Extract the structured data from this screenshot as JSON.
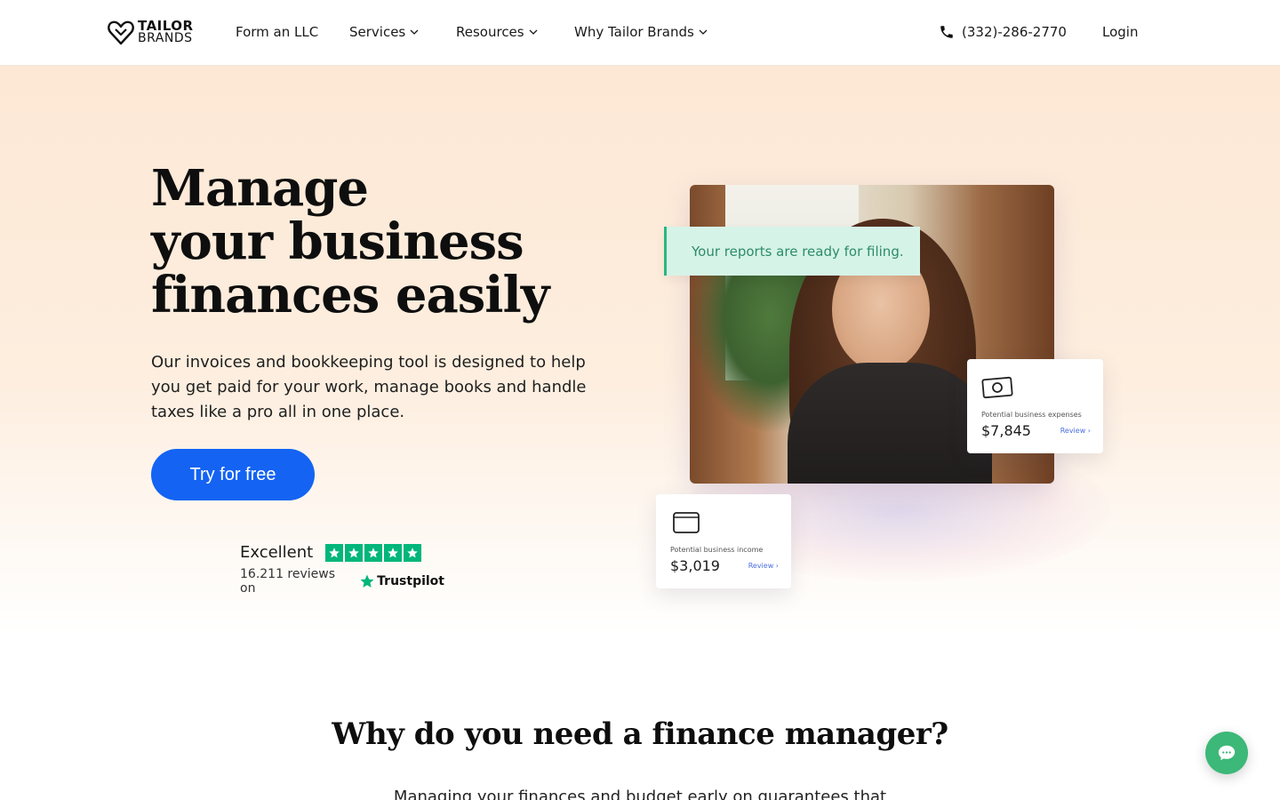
{
  "header": {
    "logo_line1": "TAILOR",
    "logo_line2": "BRANDS",
    "nav": [
      {
        "label": "Form an LLC",
        "has_dropdown": false
      },
      {
        "label": "Services",
        "has_dropdown": true
      },
      {
        "label": "Resources",
        "has_dropdown": true
      },
      {
        "label": "Why Tailor Brands",
        "has_dropdown": true
      }
    ],
    "phone": "(332)-286-2770",
    "login": "Login"
  },
  "hero": {
    "title_line1": "Manage",
    "title_line2": "your business",
    "title_line3": "finances easily",
    "subtitle": "Our invoices and bookkeeping tool is designed to help you get paid for your work, manage books and handle taxes like a pro all in one place.",
    "cta_label": "Try for free",
    "trustpilot": {
      "rating_label": "Excellent",
      "stars": 5,
      "reviews_text": "16.211 reviews on",
      "brand": "Trustpilot"
    },
    "notice": "Your reports are ready for filing.",
    "expenses_card": {
      "icon": "money-bill-icon",
      "label": "Potential business expenses",
      "value": "$7,845",
      "link": "Review"
    },
    "income_card": {
      "icon": "wallet-icon",
      "label": "Potential business income",
      "value": "$3,019",
      "link": "Review"
    }
  },
  "section": {
    "title": "Why do you need a finance manager?",
    "text": "Managing your finances and budget early on guarantees that"
  },
  "colors": {
    "accent": "#1463f3",
    "trustpilot_green": "#00b67a",
    "chat_green": "#3cb878",
    "hero_bg": "#fde8d5"
  }
}
